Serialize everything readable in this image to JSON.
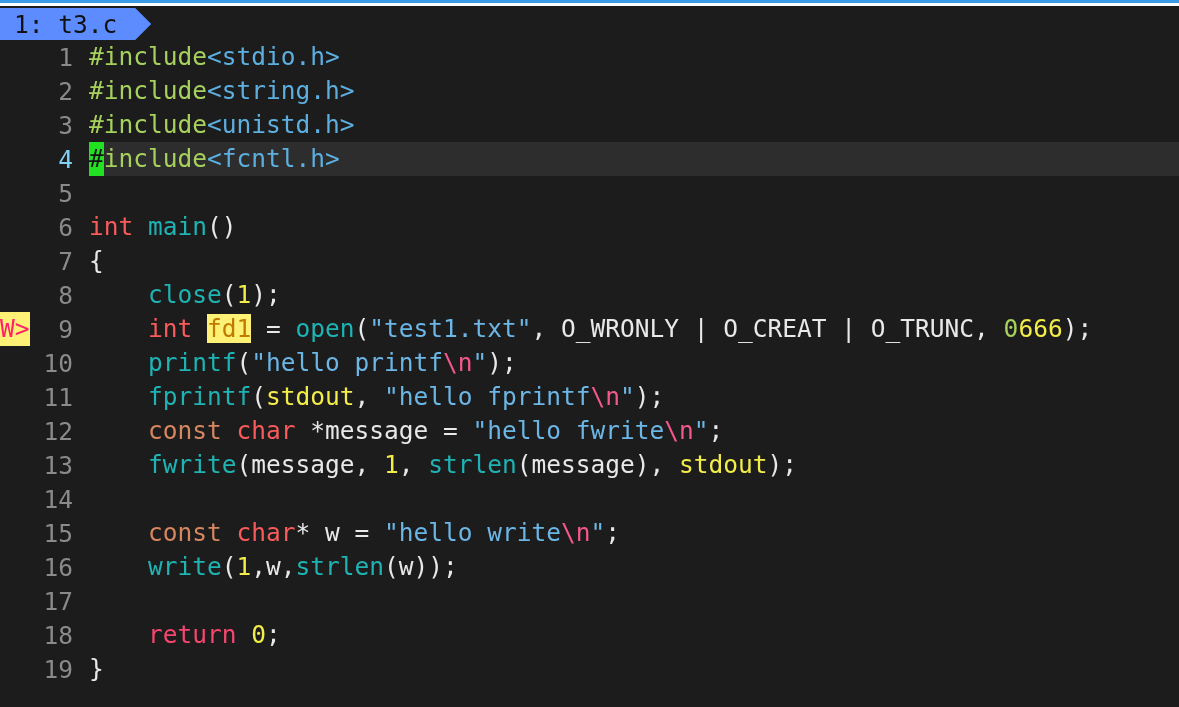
{
  "tabline": {
    "tabs": [
      {
        "label": "1: t3.c",
        "selected": true
      }
    ]
  },
  "lines": [
    {
      "number": "1",
      "current": false,
      "tokens": [
        {
          "text": "#include",
          "kind": "pre"
        },
        {
          "text": "<stdio.h>",
          "kind": "header"
        }
      ]
    },
    {
      "number": "2",
      "current": false,
      "tokens": [
        {
          "text": "#include",
          "kind": "pre"
        },
        {
          "text": "<string.h>",
          "kind": "header"
        }
      ]
    },
    {
      "number": "3",
      "current": false,
      "tokens": [
        {
          "text": "#include",
          "kind": "pre"
        },
        {
          "text": "<unistd.h>",
          "kind": "header"
        }
      ]
    },
    {
      "number": "4",
      "current": true,
      "tokens": [
        {
          "text": "#",
          "kind": "cursor"
        },
        {
          "text": "include",
          "kind": "pre"
        },
        {
          "text": "<fcntl.h>",
          "kind": "header"
        }
      ]
    },
    {
      "number": "5",
      "current": false
    },
    {
      "number": "6",
      "current": false,
      "tokens": [
        {
          "text": "int ",
          "kind": "type"
        },
        {
          "text": "main",
          "kind": "func"
        },
        {
          "text": "()",
          "kind": "plain"
        }
      ]
    },
    {
      "number": "7",
      "current": false,
      "tokens": [
        {
          "text": "{",
          "kind": "plain"
        }
      ]
    },
    {
      "number": "8",
      "current": false,
      "tokens": [
        {
          "text": "    close",
          "kind": "func"
        },
        {
          "text": "(",
          "kind": "plain"
        },
        {
          "text": "1",
          "kind": "num"
        },
        {
          "text": ");",
          "kind": "plain"
        }
      ]
    },
    {
      "number": "9",
      "current": false,
      "sign": "W>",
      "tokens": [
        {
          "text": "    int ",
          "kind": "type"
        },
        {
          "text": "fd1",
          "kind": "match"
        },
        {
          "text": " = ",
          "kind": "plain"
        },
        {
          "text": "open",
          "kind": "func"
        },
        {
          "text": "(",
          "kind": "plain"
        },
        {
          "text": "\"test1.txt\"",
          "kind": "str"
        },
        {
          "text": ", O_WRONLY | O_CREAT | O_TRUNC, ",
          "kind": "plain"
        },
        {
          "text": "0",
          "kind": "numprefix"
        },
        {
          "text": "666",
          "kind": "num"
        },
        {
          "text": ");",
          "kind": "plain"
        }
      ]
    },
    {
      "number": "10",
      "current": false,
      "tokens": [
        {
          "text": "    printf",
          "kind": "func"
        },
        {
          "text": "(",
          "kind": "plain"
        },
        {
          "text": "\"hello printf",
          "kind": "str"
        },
        {
          "text": "\\n",
          "kind": "esc"
        },
        {
          "text": "\"",
          "kind": "str"
        },
        {
          "text": ");",
          "kind": "plain"
        }
      ]
    },
    {
      "number": "11",
      "current": false,
      "tokens": [
        {
          "text": "    fprintf",
          "kind": "func"
        },
        {
          "text": "(",
          "kind": "plain"
        },
        {
          "text": "stdout",
          "kind": "var"
        },
        {
          "text": ", ",
          "kind": "plain"
        },
        {
          "text": "\"hello fprintf",
          "kind": "str"
        },
        {
          "text": "\\n",
          "kind": "esc"
        },
        {
          "text": "\"",
          "kind": "str"
        },
        {
          "text": ");",
          "kind": "plain"
        }
      ]
    },
    {
      "number": "12",
      "current": false,
      "tokens": [
        {
          "text": "    const ",
          "kind": "qual"
        },
        {
          "text": "char",
          "kind": "type"
        },
        {
          "text": " *message = ",
          "kind": "plain"
        },
        {
          "text": "\"hello fwrite",
          "kind": "str"
        },
        {
          "text": "\\n",
          "kind": "esc"
        },
        {
          "text": "\"",
          "kind": "str"
        },
        {
          "text": ";",
          "kind": "plain"
        }
      ]
    },
    {
      "number": "13",
      "current": false,
      "tokens": [
        {
          "text": "    fwrite",
          "kind": "func"
        },
        {
          "text": "(message, ",
          "kind": "plain"
        },
        {
          "text": "1",
          "kind": "num"
        },
        {
          "text": ", ",
          "kind": "plain"
        },
        {
          "text": "strlen",
          "kind": "func"
        },
        {
          "text": "(message), ",
          "kind": "plain"
        },
        {
          "text": "stdout",
          "kind": "var"
        },
        {
          "text": ");",
          "kind": "plain"
        }
      ]
    },
    {
      "number": "14",
      "current": false
    },
    {
      "number": "15",
      "current": false,
      "tokens": [
        {
          "text": "    const ",
          "kind": "qual"
        },
        {
          "text": "char",
          "kind": "type"
        },
        {
          "text": "* w = ",
          "kind": "plain"
        },
        {
          "text": "\"hello write",
          "kind": "str"
        },
        {
          "text": "\\n",
          "kind": "esc"
        },
        {
          "text": "\"",
          "kind": "str"
        },
        {
          "text": ";",
          "kind": "plain"
        }
      ]
    },
    {
      "number": "16",
      "current": false,
      "tokens": [
        {
          "text": "    write",
          "kind": "func"
        },
        {
          "text": "(",
          "kind": "plain"
        },
        {
          "text": "1",
          "kind": "num"
        },
        {
          "text": ",w,",
          "kind": "plain"
        },
        {
          "text": "strlen",
          "kind": "func"
        },
        {
          "text": "(w));",
          "kind": "plain"
        }
      ]
    },
    {
      "number": "17",
      "current": false
    },
    {
      "number": "18",
      "current": false,
      "tokens": [
        {
          "text": "    return ",
          "kind": "ret"
        },
        {
          "text": "0",
          "kind": "num"
        },
        {
          "text": ";",
          "kind": "plain"
        }
      ]
    },
    {
      "number": "19",
      "current": false,
      "tokens": [
        {
          "text": "}",
          "kind": "plain"
        }
      ]
    }
  ]
}
